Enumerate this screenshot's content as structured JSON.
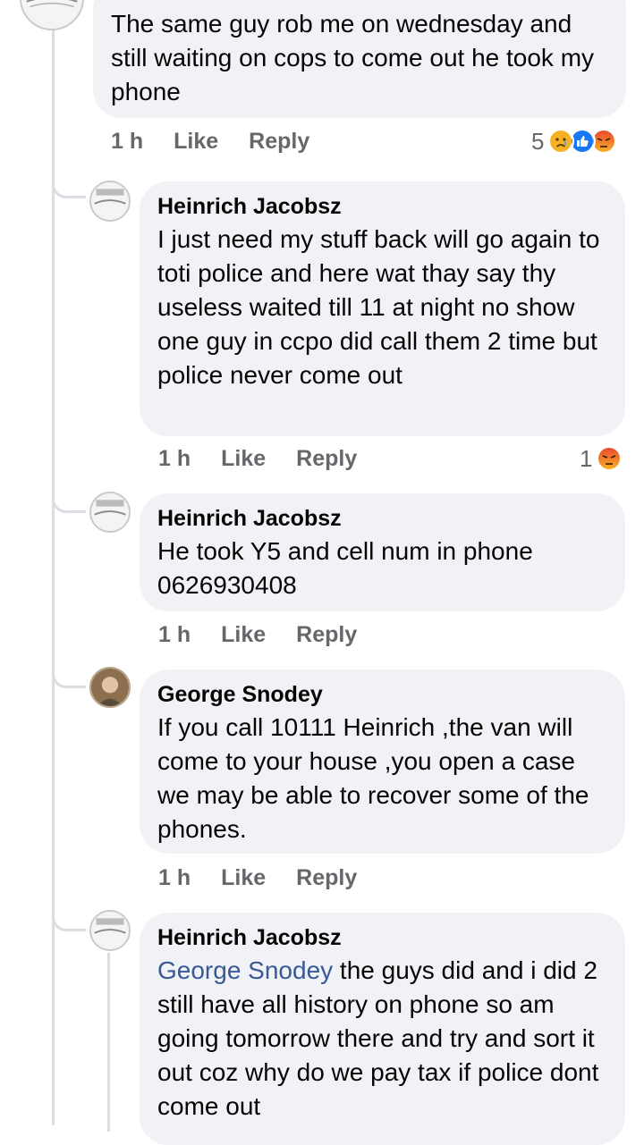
{
  "comments": [
    {
      "author": "",
      "text": "The same guy rob me on wednesday and still waiting on cops to come out he took my phone",
      "time": "1 h",
      "like_label": "Like",
      "reply_label": "Reply",
      "reaction_count": "5",
      "reactions": [
        "sad-icon",
        "like-icon",
        "angry-icon"
      ]
    },
    {
      "author": "Heinrich Jacobsz",
      "text": "I just need my stuff back will go again to toti police and here wat thay say thy useless waited till 11 at night no show one guy in ccpo did call them 2 time but police never come out",
      "time": "1 h",
      "like_label": "Like",
      "reply_label": "Reply",
      "reaction_count": "1",
      "reactions": [
        "angry-icon"
      ]
    },
    {
      "author": "Heinrich Jacobsz",
      "text": "He took Y5 and cell num in phone 0626930408",
      "time": "1 h",
      "like_label": "Like",
      "reply_label": "Reply"
    },
    {
      "author": "George Snodey",
      "text": "If you call 10111 Heinrich ,the van will come to your house ,you open a case we may be able to recover some of the phones.",
      "time": "1 h",
      "like_label": "Like",
      "reply_label": "Reply"
    },
    {
      "author": "Heinrich Jacobsz",
      "mention": "George Snodey",
      "text": " the guys did and i did 2 still have all history on phone so am going tomorrow there and try and sort it out coz why do we pay tax if police dont come out"
    }
  ],
  "colors": {
    "bubble": "#f0f2f5",
    "meta": "#65676b",
    "mention": "#385898",
    "like": "#1877f2",
    "angry": "#f2592a",
    "sad": "#f7b125"
  }
}
